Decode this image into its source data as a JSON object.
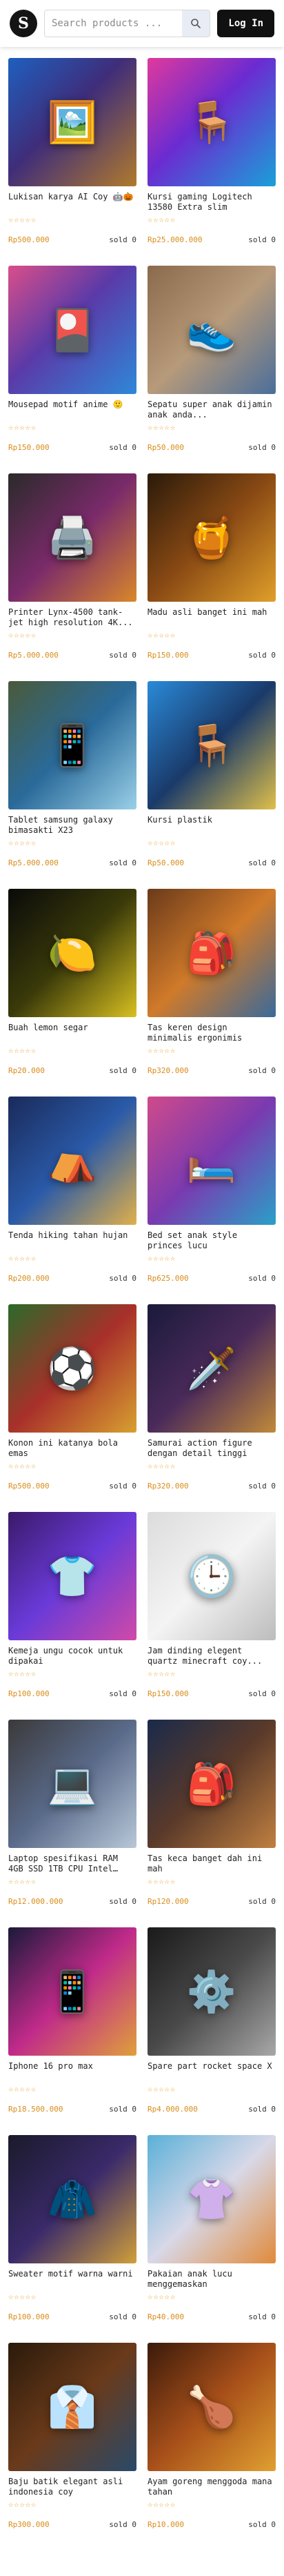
{
  "header": {
    "logo_letter": "S",
    "search_placeholder": "Search products ...",
    "login_label": "Log In"
  },
  "products": [
    {
      "title": "Lukisan karya AI Coy 🤖🎃",
      "stars": "☆☆☆☆☆",
      "price": "Rp500.000",
      "sold": "sold 0",
      "icon": "🖼️",
      "bg": "linear-gradient(135deg,#1f5fbf 0%,#3f2d7a 45%,#b07a2c 100%)"
    },
    {
      "title": "Kursi gaming Logitech 13580 Extra slim",
      "stars": "☆☆☆☆☆",
      "price": "Rp25.000.000",
      "sold": "sold 0",
      "icon": "🪑",
      "bg": "linear-gradient(135deg,#e0399c 0%,#6b2bd1 45%,#1aa0d8 100%)"
    },
    {
      "title": "Mousepad motif anime 🙂",
      "stars": "☆☆☆☆☆",
      "price": "Rp150.000",
      "sold": "sold 0",
      "icon": "🎴",
      "bg": "linear-gradient(135deg,#d94e8a 0%,#5b3aa8 45%,#2e88d8 100%)"
    },
    {
      "title": "Sepatu super anak dijamin anak anda...",
      "stars": "☆☆☆☆☆",
      "price": "Rp50.000",
      "sold": "sold 0",
      "icon": "👟",
      "bg": "linear-gradient(135deg,#8a6a4a 0%,#b79a7a 50%,#4a6e9a 100%)"
    },
    {
      "title": "Printer Lynx-4500 tank-jet high resolution 4K...",
      "stars": "☆☆☆☆☆",
      "price": "Rp5.000.000",
      "sold": "sold 0",
      "icon": "🖨️",
      "bg": "linear-gradient(135deg,#2a2a2a 0%,#7a2a6a 50%,#d9882a 100%)"
    },
    {
      "title": "Madu asli banget ini mah",
      "stars": "☆☆☆☆☆",
      "price": "Rp150.000",
      "sold": "sold 0",
      "icon": "🍯",
      "bg": "linear-gradient(135deg,#2a1a0a 0%,#8a4a14 50%,#e0a02a 100%)"
    },
    {
      "title": "Tablet samsung galaxy bimasakti X23",
      "stars": "☆☆☆☆☆",
      "price": "Rp5.000.000",
      "sold": "sold 0",
      "icon": "📱",
      "bg": "linear-gradient(135deg,#4a5a3a 0%,#2a6a9a 50%,#9ad0e8 100%)"
    },
    {
      "title": "Kursi plastik",
      "stars": "☆☆☆☆☆",
      "price": "Rp50.000",
      "sold": "sold 0",
      "icon": "🪑",
      "bg": "linear-gradient(135deg,#2a8ad8 0%,#1a3a6a 50%,#e0c04a 100%)"
    },
    {
      "title": "Buah lemon segar",
      "stars": "☆☆☆☆☆",
      "price": "Rp20.000",
      "sold": "sold 0",
      "icon": "🍋",
      "bg": "linear-gradient(135deg,#0a0a0a 0%,#3a3a0a 50%,#d8c020 100%)"
    },
    {
      "title": "Tas keren design minimalis ergonimis",
      "stars": "☆☆☆☆☆",
      "price": "Rp320.000",
      "sold": "sold 0",
      "icon": "🎒",
      "bg": "linear-gradient(135deg,#6a3a1a 0%,#d07a2a 50%,#3a6a9a 100%)"
    },
    {
      "title": "Tenda hiking tahan hujan",
      "stars": "☆☆☆☆☆",
      "price": "Rp200.000",
      "sold": "sold 0",
      "icon": "⛺",
      "bg": "linear-gradient(135deg,#1a2a5a 0%,#2a5aa8 50%,#e0b04a 100%)"
    },
    {
      "title": "Bed set anak style princes lucu",
      "stars": "☆☆☆☆☆",
      "price": "Rp625.000",
      "sold": "sold 0",
      "icon": "🛏️",
      "bg": "linear-gradient(135deg,#d04a8a 0%,#7a3ab0 50%,#2aa0c8 100%)"
    },
    {
      "title": "Konon ini katanya bola emas",
      "stars": "☆☆☆☆☆",
      "price": "Rp500.000",
      "sold": "sold 0",
      "icon": "⚽",
      "bg": "linear-gradient(135deg,#2a6a2a 0%,#a8302a 50%,#d8a030 100%)"
    },
    {
      "title": "Samurai action figure dengan detail tinggi",
      "stars": "☆☆☆☆☆",
      "price": "Rp320.000",
      "sold": "sold 0",
      "icon": "🗡️",
      "bg": "linear-gradient(135deg,#1a1a3a 0%,#4a2a5a 50%,#c08a3a 100%)"
    },
    {
      "title": "Kemeja ungu cocok untuk dipakai",
      "stars": "☆☆☆☆☆",
      "price": "Rp100.000",
      "sold": "sold 0",
      "icon": "👕",
      "bg": "linear-gradient(135deg,#3a1a6a 0%,#6a3ad8 50%,#d04aa8 100%)"
    },
    {
      "title": "Jam dinding elegent quartz minecraft coy...",
      "stars": "☆☆☆☆☆",
      "price": "Rp150.000",
      "sold": "sold 0",
      "icon": "🕒",
      "bg": "linear-gradient(135deg,#dcdcdc 0%,#f4f4f4 50%,#bcbcbc 100%)"
    },
    {
      "title": "Laptop spesifikasi RAM 4GB SSD 1TB CPU Intel i...",
      "stars": "☆☆☆☆☆",
      "price": "Rp12.000.000",
      "sold": "sold 0",
      "icon": "💻",
      "bg": "linear-gradient(135deg,#3a3a3a 0%,#5a6a8a 50%,#b8c8d8 100%)"
    },
    {
      "title": "Tas keca banget dah ini mah",
      "stars": "☆☆☆☆☆",
      "price": "Rp120.000",
      "sold": "sold 0",
      "icon": "🎒",
      "bg": "linear-gradient(135deg,#1a2a4a 0%,#5a3a2a 50%,#c08040 100%)"
    },
    {
      "title": "Iphone 16 pro max",
      "stars": "☆☆☆☆☆",
      "price": "Rp18.500.000",
      "sold": "sold 0",
      "icon": "📱",
      "bg": "linear-gradient(135deg,#1a1a3a 0%,#c02a8a 50%,#e0a03a 100%)"
    },
    {
      "title": "Spare part rocket space X",
      "stars": "☆☆☆☆☆",
      "price": "Rp4.000.000",
      "sold": "sold 0",
      "icon": "⚙️",
      "bg": "linear-gradient(135deg,#1a1a1a 0%,#4a4a4a 50%,#a8a8a8 100%)"
    },
    {
      "title": "Sweater motif warna warni",
      "stars": "☆☆☆☆☆",
      "price": "Rp100.000",
      "sold": "sold 0",
      "icon": "🧥",
      "bg": "linear-gradient(135deg,#1a1a2a 0%,#3a2a6a 50%,#d0a03a 100%)"
    },
    {
      "title": "Pakaian anak lucu menggemaskan",
      "stars": "☆☆☆☆☆",
      "price": "Rp40.000",
      "sold": "sold 0",
      "icon": "👚",
      "bg": "linear-gradient(135deg,#5ab0d8 0%,#d8d8e8 50%,#e08a3a 100%)"
    },
    {
      "title": "Baju batik elegant asli indonesia coy",
      "stars": "☆☆☆☆☆",
      "price": "Rp300.000",
      "sold": "sold 0",
      "icon": "👔",
      "bg": "linear-gradient(135deg,#2a1a0a 0%,#6a3a1a 50%,#2a4a6a 100%)"
    },
    {
      "title": "Ayam goreng menggoda mana tahan",
      "stars": "☆☆☆☆☆",
      "price": "Rp10.000",
      "sold": "sold 0",
      "icon": "🍗",
      "bg": "linear-gradient(135deg,#3a1a0a 0%,#a8501a 50%,#e0a030 100%)"
    }
  ]
}
